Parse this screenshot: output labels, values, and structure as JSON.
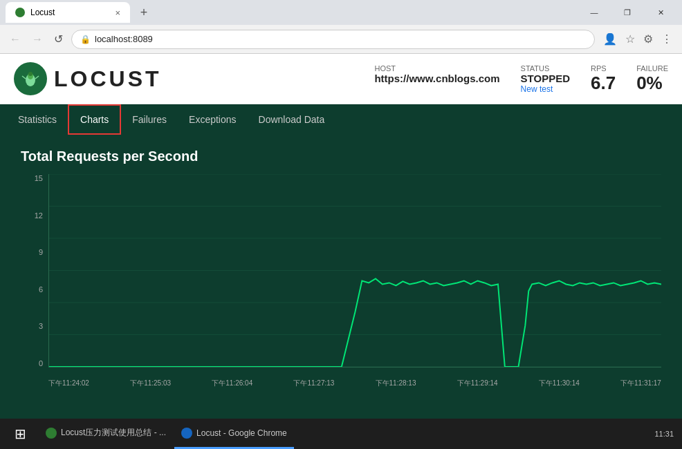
{
  "browser": {
    "title_bar": {
      "tab1_label": "Locust",
      "tab1_close": "×",
      "new_tab_icon": "+",
      "win_minimize": "—",
      "win_restore": "❐",
      "win_close": "✕"
    },
    "address_bar": {
      "back_icon": "←",
      "forward_icon": "→",
      "reload_icon": "↺",
      "url": "localhost:8089",
      "lock_icon": "🔒",
      "profile_icon": "👤",
      "star_icon": "☆",
      "menu_icon": "⋮"
    }
  },
  "locust": {
    "logo_text": "LOCUST",
    "host_label": "HOST",
    "host_value": "https://www.cnblogs.com",
    "status_label": "STATUS",
    "status_value": "STOPPED",
    "new_test_link": "New test",
    "rps_label": "RPS",
    "rps_value": "6.7",
    "failure_label": "FAILURE",
    "failure_value": "0%"
  },
  "nav": {
    "tabs": [
      {
        "label": "Statistics",
        "active": false
      },
      {
        "label": "Charts",
        "active": true
      },
      {
        "label": "Failures",
        "active": false
      },
      {
        "label": "Exceptions",
        "active": false
      },
      {
        "label": "Download Data",
        "active": false
      }
    ]
  },
  "chart": {
    "title": "Total Requests per Second",
    "y_labels": [
      "15",
      "12",
      "9",
      "6",
      "3",
      "0"
    ],
    "x_labels": [
      "下午11:24:02",
      "下午11:25:03",
      "下午11:26:04",
      "下午11:27:13",
      "下午11:28:13",
      "下午11:29:14",
      "下午11:30:14",
      "下午11:31:17"
    ]
  },
  "taskbar": {
    "item1_label": "Locust压力测试使用总结 - ...",
    "item2_label": "Locust - Google Chrome",
    "time": "11:31"
  }
}
